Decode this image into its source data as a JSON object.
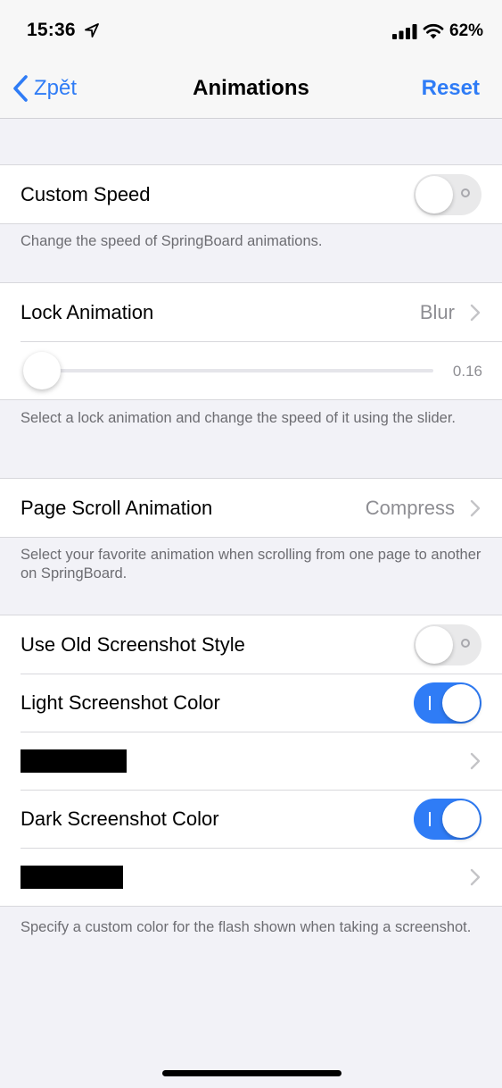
{
  "status_bar": {
    "time": "15:36",
    "battery": "62%",
    "icons": [
      "location-icon",
      "signal-icon",
      "wifi-icon"
    ]
  },
  "nav": {
    "back_label": "Zpět",
    "title": "Animations",
    "reset_label": "Reset"
  },
  "groups": {
    "custom_speed": {
      "label": "Custom Speed",
      "enabled": false,
      "footer": "Change the speed of SpringBoard animations."
    },
    "lock_animation": {
      "label": "Lock Animation",
      "value": "Blur",
      "slider_value": 0.16,
      "slider_display": "0.16",
      "footer": "Select a lock animation and change the speed of it using the slider."
    },
    "page_scroll": {
      "label": "Page Scroll Animation",
      "value": "Compress",
      "footer": "Select your favorite animation when scrolling from one page to another on SpringBoard."
    },
    "screenshot": {
      "old_style_label": "Use Old Screenshot Style",
      "old_style_enabled": false,
      "light_label": "Light Screenshot Color",
      "light_enabled": true,
      "dark_label": "Dark Screenshot Color",
      "dark_enabled": true,
      "footer": "Specify a custom color for the flash shown when taking a screenshot."
    }
  },
  "colors": {
    "accent": "#2f7cf6",
    "background": "#f2f2f7",
    "secondary_text": "#8e8e93",
    "footer_text": "#6d6d72",
    "toggle_off": "#e9e9ea"
  }
}
